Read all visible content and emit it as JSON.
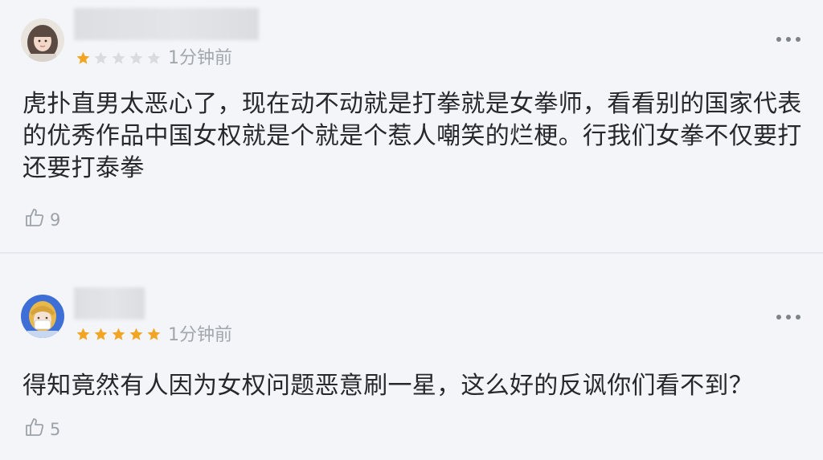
{
  "comments": [
    {
      "rating": 1,
      "max_rating": 5,
      "time": "1分钟前",
      "text": "虎扑直男太恶心了，现在动不动就是打拳就是女拳师，看看别的国家代表的优秀作品中国女权就是个就是个惹人嘲笑的烂梗。行我们女拳不仅要打还要打泰拳",
      "likes": "9",
      "avatar_icon": "avatar-girl-image"
    },
    {
      "rating": 5,
      "max_rating": 5,
      "time": "1分钟前",
      "text": "得知竟然有人因为女权问题恶意刷一星，这么好的反讽你们看不到？",
      "likes": "5",
      "avatar_icon": "avatar-anime-image"
    }
  ],
  "colors": {
    "background": "#f3f5f8",
    "star_filled": "#f2a525",
    "star_empty": "#d9dcdf",
    "text": "#26282c",
    "muted": "#a2a7ae"
  },
  "icons": {
    "more": "more-dots-icon",
    "like": "thumbs-up-icon",
    "star": "star-icon"
  }
}
